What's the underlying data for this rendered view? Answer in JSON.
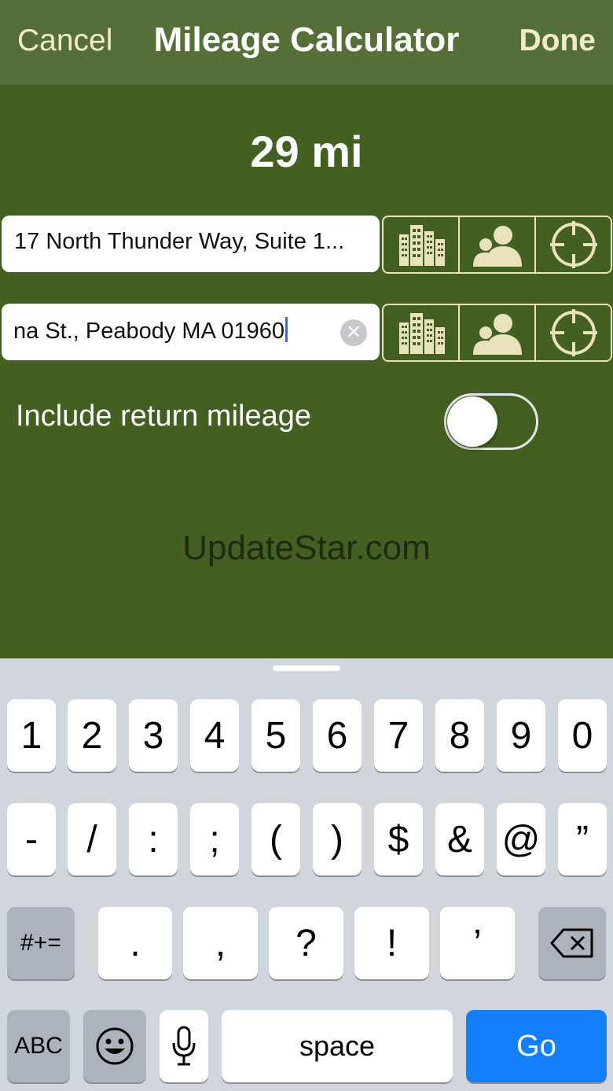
{
  "nav": {
    "cancel": "Cancel",
    "title": "Mileage Calculator",
    "done": "Done"
  },
  "distance": "29 mi",
  "from_field": {
    "value": "17 North Thunder Way, Suite 1..."
  },
  "to_field": {
    "value": "na St., Peabody MA 01960"
  },
  "field_buttons": [
    "buildings-icon",
    "contacts-icon",
    "crosshair-icon"
  ],
  "return_mileage": {
    "label": "Include return mileage",
    "on": false
  },
  "watermark": "UpdateStar.com",
  "keyboard": {
    "row1": [
      "1",
      "2",
      "3",
      "4",
      "5",
      "6",
      "7",
      "8",
      "9",
      "0"
    ],
    "row2": [
      "-",
      "/",
      ":",
      ";",
      "(",
      ")",
      "$",
      "&",
      "@",
      "”"
    ],
    "row3": {
      "mode_key": "#+=",
      "keys": [
        ".",
        ",",
        "?",
        "!",
        "’"
      ]
    },
    "row4": {
      "abc": "ABC",
      "space": "space",
      "go": "Go"
    }
  },
  "colors": {
    "background": "#435f22",
    "nav": "#566f38",
    "go_key": "#157efb"
  }
}
